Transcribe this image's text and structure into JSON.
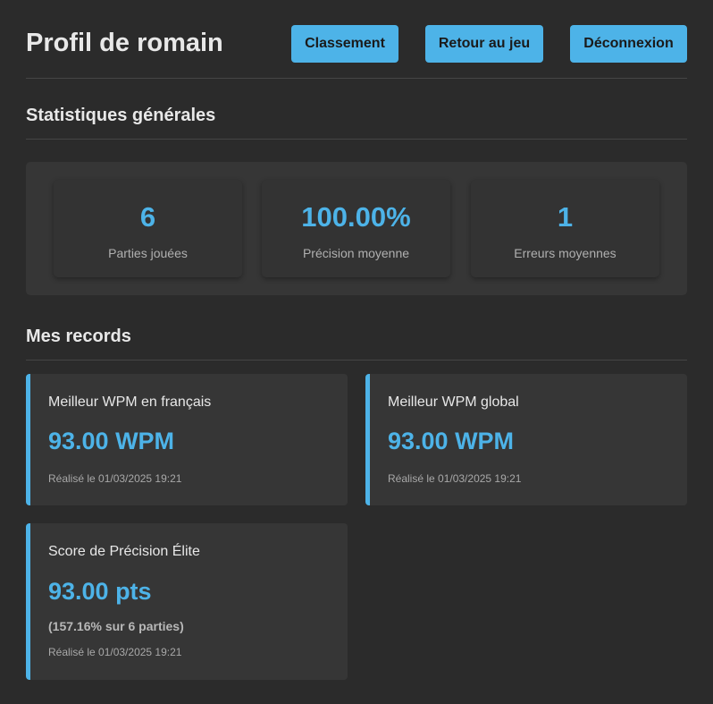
{
  "header": {
    "title": "Profil de romain",
    "buttons": {
      "classement": "Classement",
      "retour": "Retour au jeu",
      "deconnexion": "Déconnexion"
    }
  },
  "stats": {
    "heading": "Statistiques générales",
    "cards": [
      {
        "value": "6",
        "label": "Parties jouées"
      },
      {
        "value": "100.00%",
        "label": "Précision moyenne"
      },
      {
        "value": "1",
        "label": "Erreurs moyennes"
      }
    ]
  },
  "records": {
    "heading": "Mes records",
    "cards": [
      {
        "title": "Meilleur WPM en français",
        "value": "93.00 WPM",
        "date": "Réalisé le 01/03/2025 19:21"
      },
      {
        "title": "Meilleur WPM global",
        "value": "93.00 WPM",
        "date": "Réalisé le 01/03/2025 19:21"
      },
      {
        "title": "Score de Précision Élite",
        "value": "93.00 pts",
        "extra": "(157.16% sur 6 parties)",
        "date": "Réalisé le 01/03/2025 19:21"
      }
    ]
  },
  "colors": {
    "accent": "#4db3e8",
    "background": "#2b2b2b",
    "card": "#363636"
  }
}
